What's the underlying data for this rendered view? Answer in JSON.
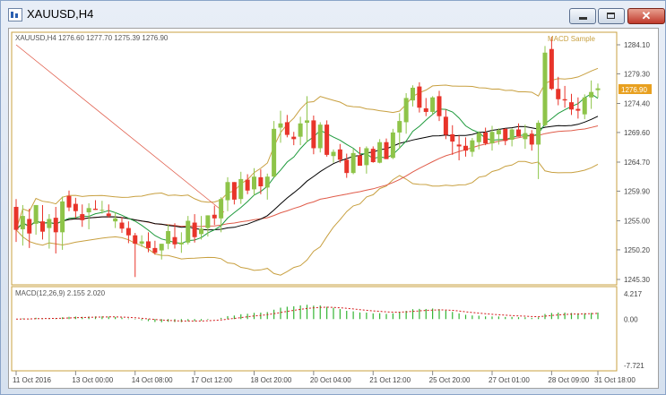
{
  "window": {
    "title": "XAUUSD,H4",
    "minimize_label": "minimize",
    "maximize_label": "maximize",
    "close_label": "✕"
  },
  "main_chart": {
    "header": "XAUUSD,H4  1276.60 1277.70 1275.39 1276.90",
    "indicator_name": "MACD Sample",
    "current_price": "1276.90",
    "price_axis": [
      "1284.10",
      "1279.30",
      "1274.40",
      "1269.60",
      "1264.70",
      "1259.90",
      "1255.00",
      "1250.20",
      "1245.30"
    ]
  },
  "macd_panel": {
    "header": "MACD(12,26,9) 2.155 2.020",
    "axis": [
      "4.217",
      "0.00",
      "-7.721"
    ]
  },
  "time_axis": [
    "11 Oct 2016",
    "13 Oct 00:00",
    "14 Oct 08:00",
    "17 Oct 12:00",
    "18 Oct 20:00",
    "20 Oct 04:00",
    "21 Oct 12:00",
    "25 Oct 20:00",
    "27 Oct 01:00",
    "28 Oct 09:00",
    "31 Oct 18:00"
  ],
  "colors": {
    "bull_candle": "#8ec449",
    "bear_candle": "#e8342a",
    "bands": "#c8a040",
    "ma_fast": "#1e9a3c",
    "ma_slow": "#000000",
    "ma_long": "#e05c4a",
    "trend_line": "#e05c4a",
    "macd_hist": "#33b533",
    "macd_signal": "#d41c1c",
    "axis_text": "#555555",
    "accent": "#c8a040"
  },
  "chart_data": [
    {
      "type": "candlestick",
      "symbol": "XAUUSD",
      "timeframe": "H4",
      "ohlc_last": {
        "open": 1276.6,
        "high": 1277.7,
        "low": 1275.39,
        "close": 1276.9
      },
      "ylim": [
        1243.0,
        1287.0
      ],
      "x_labels": [
        "11 Oct 2016",
        "13 Oct 00:00",
        "14 Oct 08:00",
        "17 Oct 12:00",
        "18 Oct 20:00",
        "20 Oct 04:00",
        "21 Oct 12:00",
        "25 Oct 20:00",
        "27 Oct 01:00",
        "28 Oct 09:00",
        "31 Oct 18:00"
      ],
      "y_ticks": [
        1284.1,
        1279.3,
        1274.4,
        1269.6,
        1264.7,
        1259.9,
        1255.0,
        1250.2,
        1245.3
      ],
      "candles": [
        [
          1257.3,
          1258.6,
          1251.5,
          1253.5
        ],
        [
          1253.6,
          1257.6,
          1250.9,
          1255.8
        ],
        [
          1255.3,
          1257.0,
          1250.5,
          1252.9
        ],
        [
          1254.5,
          1257.6,
          1252.7,
          1257.6
        ],
        [
          1254.9,
          1257.6,
          1251.9,
          1253.2
        ],
        [
          1253.8,
          1256.1,
          1250.4,
          1255.3
        ],
        [
          1255.5,
          1257.3,
          1249.6,
          1253.1
        ],
        [
          1253.1,
          1259.0,
          1250.2,
          1258.2
        ],
        [
          1259.1,
          1260.0,
          1256.6,
          1257.2
        ],
        [
          1257.8,
          1258.8,
          1255.5,
          1256.6
        ],
        [
          1256.1,
          1257.7,
          1254.0,
          1255.1
        ],
        [
          1256.4,
          1257.9,
          1253.6,
          1257.1
        ],
        [
          1257.0,
          1258.4,
          1256.8,
          1256.8
        ],
        [
          1256.7,
          1258.3,
          1256.2,
          1256.8
        ],
        [
          1256.2,
          1257.7,
          1255.5,
          1255.8
        ],
        [
          1254.9,
          1256.4,
          1253.8,
          1255.4
        ],
        [
          1254.7,
          1255.6,
          1253.0,
          1253.7
        ],
        [
          1253.8,
          1254.9,
          1251.3,
          1252.6
        ],
        [
          1252.6,
          1253.0,
          1245.7,
          1251.2
        ],
        [
          1251.2,
          1252.6,
          1250.7,
          1251.6
        ],
        [
          1251.6,
          1253.1,
          1249.8,
          1250.5
        ],
        [
          1250.5,
          1251.7,
          1249.4,
          1249.7
        ],
        [
          1250.1,
          1251.2,
          1248.6,
          1251.2
        ],
        [
          1251.2,
          1254.4,
          1250.3,
          1253.3
        ],
        [
          1252.3,
          1254.6,
          1250.4,
          1251.1
        ],
        [
          1251.1,
          1253.1,
          1249.7,
          1251.4
        ],
        [
          1251.4,
          1255.8,
          1251.1,
          1255.0
        ],
        [
          1254.7,
          1256.1,
          1251.4,
          1252.3
        ],
        [
          1252.8,
          1255.8,
          1251.9,
          1253.7
        ],
        [
          1253.8,
          1255.9,
          1252.4,
          1255.9
        ],
        [
          1256.0,
          1257.5,
          1254.3,
          1255.4
        ],
        [
          1255.4,
          1258.9,
          1253.1,
          1258.6
        ],
        [
          1258.4,
          1262.2,
          1256.6,
          1261.4
        ],
        [
          1261.4,
          1261.4,
          1257.7,
          1258.5
        ],
        [
          1258.6,
          1263.1,
          1257.8,
          1261.9
        ],
        [
          1261.8,
          1262.7,
          1259.4,
          1260.0
        ],
        [
          1260.2,
          1263.7,
          1259.2,
          1262.3
        ],
        [
          1262.2,
          1263.5,
          1259.4,
          1260.7
        ],
        [
          1260.5,
          1262.8,
          1258.5,
          1262.3
        ],
        [
          1262.3,
          1271.5,
          1262.2,
          1270.2
        ],
        [
          1270.4,
          1273.2,
          1267.9,
          1271.1
        ],
        [
          1271.3,
          1272.5,
          1268.8,
          1269.2
        ],
        [
          1268.9,
          1269.7,
          1267.5,
          1268.5
        ],
        [
          1268.9,
          1272.2,
          1267.5,
          1271.1
        ],
        [
          1271.2,
          1275.6,
          1268.0,
          1271.6
        ],
        [
          1271.6,
          1272.4,
          1266.0,
          1267.0
        ],
        [
          1267.0,
          1271.3,
          1266.3,
          1270.9
        ],
        [
          1270.9,
          1271.6,
          1265.6,
          1265.9
        ],
        [
          1265.7,
          1266.8,
          1264.6,
          1266.4
        ],
        [
          1266.8,
          1267.7,
          1264.6,
          1265.1
        ],
        [
          1265.1,
          1266.1,
          1262.1,
          1262.9
        ],
        [
          1262.9,
          1266.9,
          1262.7,
          1266.2
        ],
        [
          1265.8,
          1267.2,
          1264.1,
          1264.1
        ],
        [
          1264.2,
          1267.3,
          1262.8,
          1267.0
        ],
        [
          1266.9,
          1267.3,
          1264.6,
          1264.7
        ],
        [
          1264.6,
          1268.5,
          1264.5,
          1268.0
        ],
        [
          1268.0,
          1268.6,
          1265.2,
          1265.2
        ],
        [
          1265.4,
          1270.2,
          1265.2,
          1269.6
        ],
        [
          1269.6,
          1272.8,
          1266.9,
          1271.5
        ],
        [
          1271.3,
          1276.1,
          1269.4,
          1275.3
        ],
        [
          1274.9,
          1277.4,
          1273.9,
          1277.0
        ],
        [
          1277.2,
          1277.9,
          1272.9,
          1273.7
        ],
        [
          1273.6,
          1275.3,
          1272.3,
          1273.0
        ],
        [
          1273.0,
          1275.6,
          1272.6,
          1275.4
        ],
        [
          1275.6,
          1276.5,
          1271.5,
          1272.3
        ],
        [
          1272.2,
          1273.4,
          1268.5,
          1269.2
        ],
        [
          1269.3,
          1270.8,
          1265.9,
          1268.1
        ],
        [
          1267.6,
          1269.1,
          1265.0,
          1267.3
        ],
        [
          1267.4,
          1268.8,
          1265.6,
          1266.6
        ],
        [
          1266.4,
          1268.7,
          1265.6,
          1268.3
        ],
        [
          1268.0,
          1269.8,
          1266.8,
          1269.5
        ],
        [
          1269.6,
          1270.4,
          1267.5,
          1267.8
        ],
        [
          1267.8,
          1270.7,
          1266.6,
          1269.7
        ],
        [
          1269.3,
          1270.3,
          1267.6,
          1270.0
        ],
        [
          1270.2,
          1270.3,
          1267.5,
          1268.2
        ],
        [
          1268.4,
          1270.3,
          1267.3,
          1270.1
        ],
        [
          1270.1,
          1271.1,
          1268.9,
          1268.9
        ],
        [
          1268.5,
          1270.9,
          1266.9,
          1269.5
        ],
        [
          1269.4,
          1270.0,
          1266.6,
          1267.6
        ],
        [
          1267.6,
          1271.6,
          1261.9,
          1271.2
        ],
        [
          1270.8,
          1283.9,
          1270.6,
          1282.8
        ],
        [
          1283.4,
          1285.4,
          1276.6,
          1276.8
        ],
        [
          1276.8,
          1278.8,
          1274.1,
          1275.1
        ],
        [
          1275.1,
          1277.3,
          1273.7,
          1274.9
        ],
        [
          1274.6,
          1276.0,
          1272.5,
          1273.4
        ],
        [
          1273.5,
          1275.4,
          1271.9,
          1273.2
        ],
        [
          1272.6,
          1275.9,
          1271.8,
          1275.4
        ],
        [
          1275.4,
          1278.2,
          1273.5,
          1276.3
        ],
        [
          1276.6,
          1277.7,
          1275.39,
          1276.9
        ]
      ]
    },
    {
      "type": "bar",
      "name": "MACD(12,26,9)",
      "value_main": 2.155,
      "value_signal": 2.02,
      "ylim": [
        -7.721,
        4.217
      ],
      "y_ticks": [
        4.217,
        0.0,
        -7.721
      ]
    }
  ]
}
